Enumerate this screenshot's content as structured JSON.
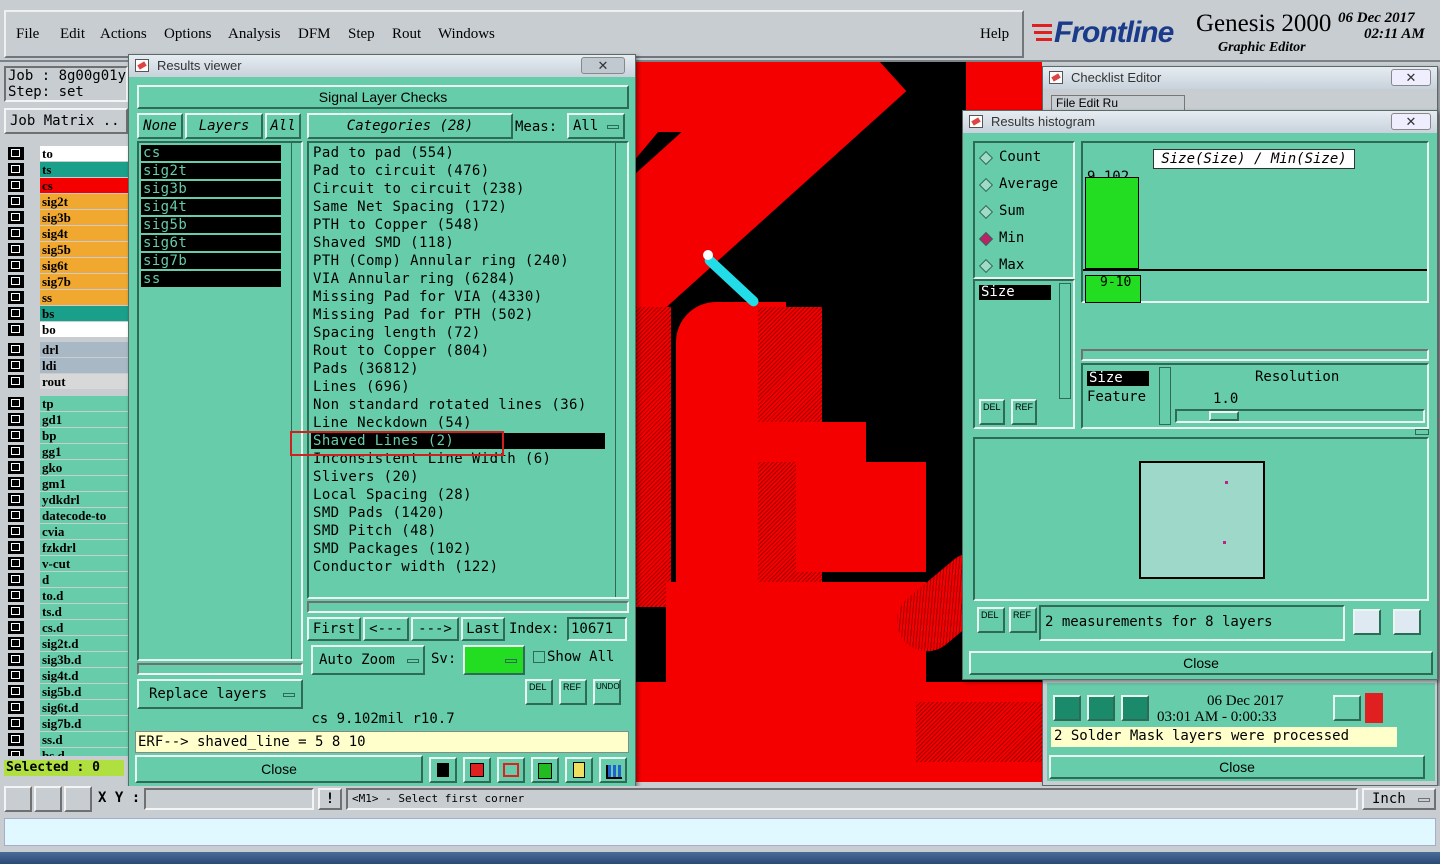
{
  "menu": {
    "items": [
      "File",
      "Edit",
      "Actions",
      "Options",
      "Analysis",
      "DFM",
      "Step",
      "Rout",
      "Windows"
    ],
    "help": "Help"
  },
  "brand": {
    "logo": "Frontline",
    "product": "Genesis 2000",
    "subtitle": "Graphic Editor",
    "date": "06 Dec 2017",
    "time": "02:11 AM"
  },
  "left": {
    "job_label": "Job : 8g00g01y",
    "step_label": "Step: set",
    "job_matrix": "Job Matrix ..",
    "group1": [
      {
        "name": "to",
        "bg": "#ffffff"
      },
      {
        "name": "ts",
        "bg": "#1aa08a"
      },
      {
        "name": "cs",
        "bg": "#f40000"
      },
      {
        "name": "sig2t",
        "bg": "#f0a830"
      },
      {
        "name": "sig3b",
        "bg": "#f0a830"
      },
      {
        "name": "sig4t",
        "bg": "#f0a830"
      },
      {
        "name": "sig5b",
        "bg": "#f0a830"
      },
      {
        "name": "sig6t",
        "bg": "#f0a830"
      },
      {
        "name": "sig7b",
        "bg": "#f0a830"
      },
      {
        "name": "ss",
        "bg": "#f0a830"
      },
      {
        "name": "bs",
        "bg": "#1aa08a"
      },
      {
        "name": "bo",
        "bg": "#ffffff"
      }
    ],
    "group2": [
      {
        "name": "drl",
        "bg": "#a8b8c4"
      },
      {
        "name": "ldi",
        "bg": "#a8b8c4"
      },
      {
        "name": "rout",
        "bg": "#d8d8d8"
      }
    ],
    "group3": [
      {
        "name": "tp",
        "bg": "#66ccaa"
      },
      {
        "name": "gd1",
        "bg": "#66ccaa"
      },
      {
        "name": "bp",
        "bg": "#66ccaa"
      },
      {
        "name": "gg1",
        "bg": "#66ccaa"
      },
      {
        "name": "gko",
        "bg": "#66ccaa"
      },
      {
        "name": "gm1",
        "bg": "#66ccaa"
      },
      {
        "name": "ydkdrl",
        "bg": "#66ccaa"
      },
      {
        "name": "datecode-to",
        "bg": "#66ccaa"
      },
      {
        "name": "cvia",
        "bg": "#66ccaa"
      },
      {
        "name": "fzkdrl",
        "bg": "#66ccaa"
      },
      {
        "name": "v-cut",
        "bg": "#66ccaa"
      },
      {
        "name": "d",
        "bg": "#66ccaa"
      },
      {
        "name": "to.d",
        "bg": "#66ccaa"
      },
      {
        "name": "ts.d",
        "bg": "#66ccaa"
      },
      {
        "name": "cs.d",
        "bg": "#66ccaa"
      },
      {
        "name": "sig2t.d",
        "bg": "#66ccaa"
      },
      {
        "name": "sig3b.d",
        "bg": "#66ccaa"
      },
      {
        "name": "sig4t.d",
        "bg": "#66ccaa"
      },
      {
        "name": "sig5b.d",
        "bg": "#66ccaa"
      },
      {
        "name": "sig6t.d",
        "bg": "#66ccaa"
      },
      {
        "name": "sig7b.d",
        "bg": "#66ccaa"
      },
      {
        "name": "ss.d",
        "bg": "#66ccaa"
      },
      {
        "name": "bs.d",
        "bg": "#66ccaa"
      }
    ],
    "selected": "Selected : 0"
  },
  "results": {
    "title": "Results viewer",
    "header": "Signal Layer Checks",
    "none": "None",
    "layers_label": "Layers",
    "all": "All",
    "categories_label": "Categories (28)",
    "meas_label": "Meas:",
    "meas_value": "All",
    "layers": [
      "cs",
      "sig2t",
      "sig3b",
      "sig4t",
      "sig5b",
      "sig6t",
      "sig7b",
      "ss"
    ],
    "categories": [
      "Pad to pad (554)",
      "Pad to circuit (476)",
      "Circuit to circuit (238)",
      "Same Net Spacing (172)",
      "PTH to Copper (548)",
      "Shaved SMD (118)",
      "PTH (Comp) Annular ring (240)",
      "VIA Annular ring (6284)",
      "Missing Pad for VIA (4330)",
      "Missing Pad for PTH (502)",
      "Spacing length (72)",
      "Rout to Copper (804)",
      "Pads (36812)",
      "Lines (696)",
      "Non standard rotated lines (36)",
      "Line Neckdown (54)",
      "Shaved Lines (2)",
      "Inconsistent Line Width (6)",
      "Slivers (20)",
      "Local Spacing (28)",
      "SMD Pads (1420)",
      "SMD Pitch (48)",
      "SMD Packages (102)",
      "Conductor width (122)"
    ],
    "selected_index": 16,
    "first": "First",
    "prev": "<---",
    "next": "--->",
    "last": "Last",
    "index_label": "Index:",
    "index_value": "10671",
    "auto_zoom": "Auto Zoom",
    "sv_label": "Sv:",
    "show_all": "Show All",
    "replace_layers": "Replace layers",
    "del": "DEL",
    "ref": "REF",
    "undo": "UNDO",
    "info": "cs  9.102mil  r10.7",
    "erf": "ERF--> shaved_line = 5 8 10",
    "close": "Close"
  },
  "histogram": {
    "title": "Results histogram",
    "options": [
      "Count",
      "Average",
      "Sum",
      "Min",
      "Max"
    ],
    "selected_option": "Min",
    "ratio_label": "Size(Size) / Min(Size)",
    "list": [
      "Size"
    ],
    "bar_value": "9.102",
    "bar_fraction": 1.0,
    "bin_label": "9-10",
    "sel_list": [
      "Size",
      "Feature"
    ],
    "resolution_label": "Resolution",
    "resolution_value": "1.0",
    "resolution_fraction": 0.13,
    "status": "2 measurements for 8 layers",
    "del": "DEL",
    "ref": "REF",
    "close": "Close"
  },
  "checklist": {
    "title": "Checklist Editor",
    "menu": "File  Edit  Ru",
    "date": "06 Dec 2017",
    "time": "03:01 AM - 0:00:33",
    "message": "2 Solder Mask layers were processed",
    "close": "Close"
  },
  "statusbar": {
    "xy": "X Y :",
    "prompt": "<M1> - Select first corner",
    "unit": "Inch"
  }
}
